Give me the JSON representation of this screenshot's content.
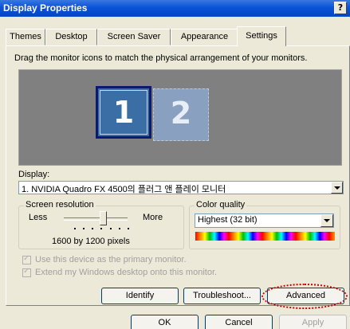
{
  "window": {
    "title": "Display Properties",
    "help_label": "?"
  },
  "tabs": [
    {
      "label": "Themes"
    },
    {
      "label": "Desktop"
    },
    {
      "label": "Screen Saver"
    },
    {
      "label": "Appearance"
    },
    {
      "label": "Settings"
    }
  ],
  "active_tab": "Settings",
  "instructions": "Drag the monitor icons to match the physical arrangement of your monitors.",
  "monitors": [
    {
      "number": "1"
    },
    {
      "number": "2"
    }
  ],
  "display": {
    "label": "Display:",
    "value": "1. NVIDIA Quadro FX 4500의 플러그 앤 플레이 모니터"
  },
  "screen_resolution": {
    "title": "Screen resolution",
    "less": "Less",
    "more": "More",
    "value": "1600 by 1200 pixels"
  },
  "color_quality": {
    "title": "Color quality",
    "value": "Highest (32 bit)"
  },
  "options": {
    "primary": "Use this device as the primary monitor.",
    "extend": "Extend my Windows desktop onto this monitor."
  },
  "buttons": {
    "identify": "Identify",
    "troubleshoot": "Troubleshoot...",
    "advanced": "Advanced",
    "ok": "OK",
    "cancel": "Cancel",
    "apply": "Apply"
  },
  "colors": {
    "titlebar": "#0a52d8",
    "window_bg": "#ece9d8",
    "monitor_area": "#808080",
    "monitor_1": "#3a6ea5",
    "monitor_2": "#8aa0c0",
    "annotation": "#d00000"
  }
}
